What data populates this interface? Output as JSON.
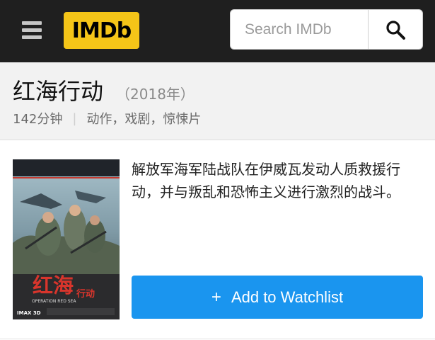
{
  "header": {
    "logo_text": "IMDb",
    "search_placeholder": "Search IMDb",
    "brand_color": "#f5c518",
    "bar_color": "#1f1f1f",
    "icons": [
      "menu-icon",
      "search-icon"
    ]
  },
  "movie": {
    "title": "红海行动",
    "year": "（2018年）",
    "runtime": "142分钟",
    "meta_separator": "|",
    "genres": "动作，戏剧，惊悚片",
    "plot": "解放军海军陆战队在伊威瓦发动人质救援行动，并与叛乱和恐怖主义进行激烈的战斗。"
  },
  "poster": {
    "title_art": "红海",
    "subtitle_art": "行动",
    "english_title": "OPERATION RED SEA",
    "format_text": "IMAX 3D"
  },
  "actions": {
    "watchlist_icon": "+",
    "watchlist_label": "Add to Watchlist",
    "accent_color": "#1a95ef"
  }
}
